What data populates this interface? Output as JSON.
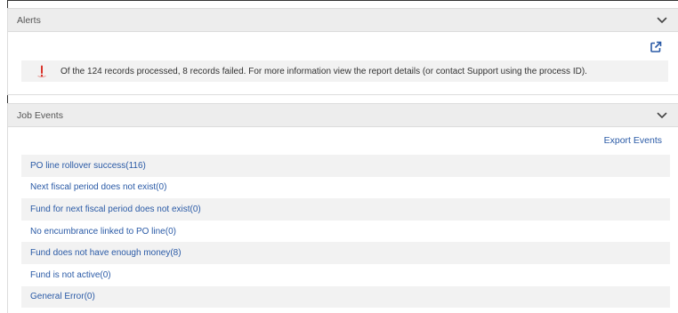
{
  "alerts": {
    "title": "Alerts",
    "message": "Of the 124 records processed, 8 records failed. For more information view the report details (or contact Support using the process ID).",
    "icons": {
      "toggle": "chevron-down-icon",
      "open": "open-external-icon",
      "status": "exclamation-icon"
    }
  },
  "job_events": {
    "title": "Job Events",
    "export_label": "Export Events",
    "items": [
      {
        "label": "PO line rollover success(116)"
      },
      {
        "label": "Next fiscal period does not exist(0)"
      },
      {
        "label": "Fund for next fiscal period does not exist(0)"
      },
      {
        "label": "No encumbrance linked to PO line(0)"
      },
      {
        "label": "Fund does not have enough money(8)"
      },
      {
        "label": "Fund is not active(0)"
      },
      {
        "label": "General Error(0)"
      }
    ]
  },
  "colors": {
    "link": "#2a5aa6",
    "header_bg": "#ededed",
    "alert_icon": "#d9342b",
    "row_shade": "#f2f2f2"
  }
}
